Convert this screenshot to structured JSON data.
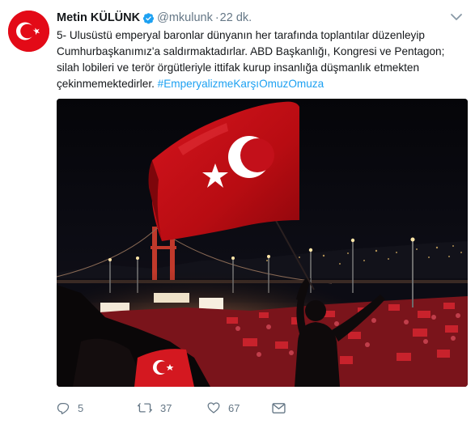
{
  "tweet": {
    "author": {
      "display_name": "Metin KÜLÜNK",
      "handle": "@mkulunk",
      "verified": true,
      "avatar_icon": "turkish-flag"
    },
    "separator": "·",
    "timestamp": "22 dk.",
    "text_line_1": "5- Ulusüstü emperyal baronlar dünyanın her tarafında toplantılar düzenleyip",
    "text_line_2": "Cumhurbaşkanımız'a saldırmaktadırlar. ABD Başkanlığı, Kongresi ve Pentagon;",
    "text_line_3": "silah lobileri ve terör örgütleriyle ittifak kurup insanlığa düşmanlık etmekten",
    "text_line_4": "çekinmemektedirler.",
    "hashtag": "#EmperyalizmeKarşıOmuzOmuza",
    "actions": {
      "reply_count": "5",
      "retweet_count": "37",
      "like_count": "67"
    }
  },
  "colors": {
    "link": "#1da1f2",
    "muted": "#657786",
    "flag_red": "#e30a17"
  },
  "icons": [
    "verified-badge-icon",
    "chevron-down-icon",
    "reply-icon",
    "retweet-icon",
    "like-icon",
    "direct-message-icon"
  ]
}
